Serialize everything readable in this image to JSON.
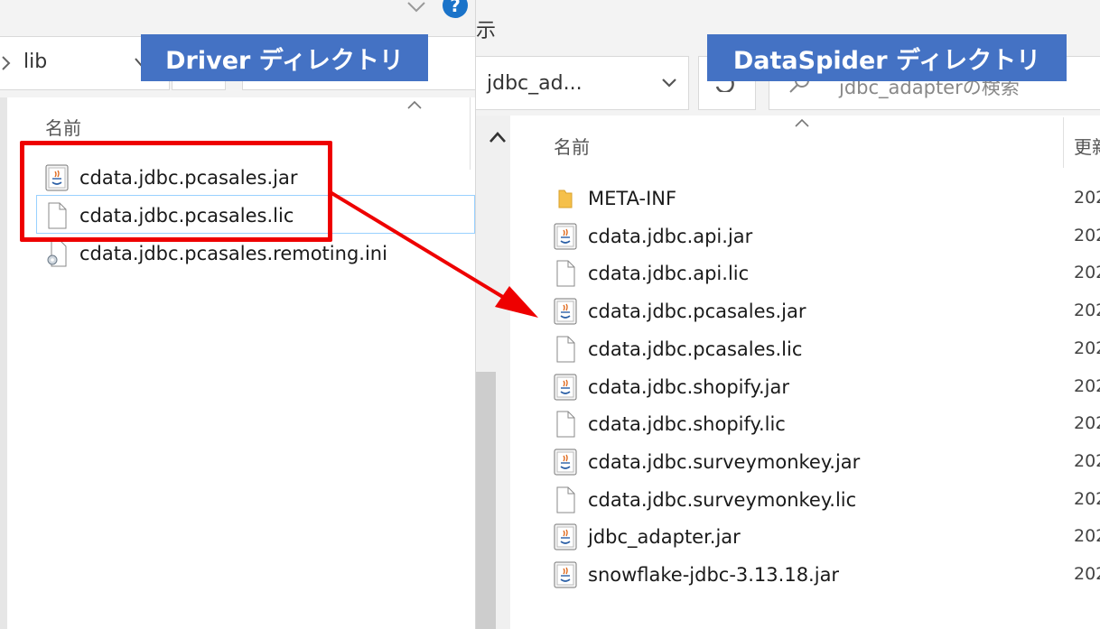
{
  "left": {
    "banner": "Driver ディレクトリ",
    "breadcrumb": "lib",
    "column_name": "名前",
    "files": [
      {
        "name": "cdata.jdbc.pcasales.jar",
        "icon": "java-jar-icon"
      },
      {
        "name": "cdata.jdbc.pcasales.lic",
        "icon": "blank-file-icon"
      },
      {
        "name": "cdata.jdbc.pcasales.remoting.ini",
        "icon": "settings-file-icon"
      }
    ]
  },
  "right": {
    "banner": "DataSpider ディレクトリ",
    "top_fragment": "示",
    "breadcrumb": "jdbc_ad...",
    "search_placeholder": "jdbc_adapterの検索",
    "column_name": "名前",
    "column_modified": "更新",
    "date_stub": "202",
    "files": [
      {
        "name": "META-INF",
        "icon": "folder-icon"
      },
      {
        "name": "cdata.jdbc.api.jar",
        "icon": "java-jar-icon"
      },
      {
        "name": "cdata.jdbc.api.lic",
        "icon": "blank-file-icon"
      },
      {
        "name": "cdata.jdbc.pcasales.jar",
        "icon": "java-jar-icon"
      },
      {
        "name": "cdata.jdbc.pcasales.lic",
        "icon": "blank-file-icon"
      },
      {
        "name": "cdata.jdbc.shopify.jar",
        "icon": "java-jar-icon"
      },
      {
        "name": "cdata.jdbc.shopify.lic",
        "icon": "blank-file-icon"
      },
      {
        "name": "cdata.jdbc.surveymonkey.jar",
        "icon": "java-jar-icon"
      },
      {
        "name": "cdata.jdbc.surveymonkey.lic",
        "icon": "blank-file-icon"
      },
      {
        "name": "jdbc_adapter.jar",
        "icon": "java-jar-icon"
      },
      {
        "name": "snowflake-jdbc-3.13.18.jar",
        "icon": "java-jar-icon"
      }
    ]
  },
  "colors": {
    "banner": "#4472c4",
    "highlight": "#ee0000",
    "arrow": "#ee0000",
    "help": "#1a73c9"
  }
}
